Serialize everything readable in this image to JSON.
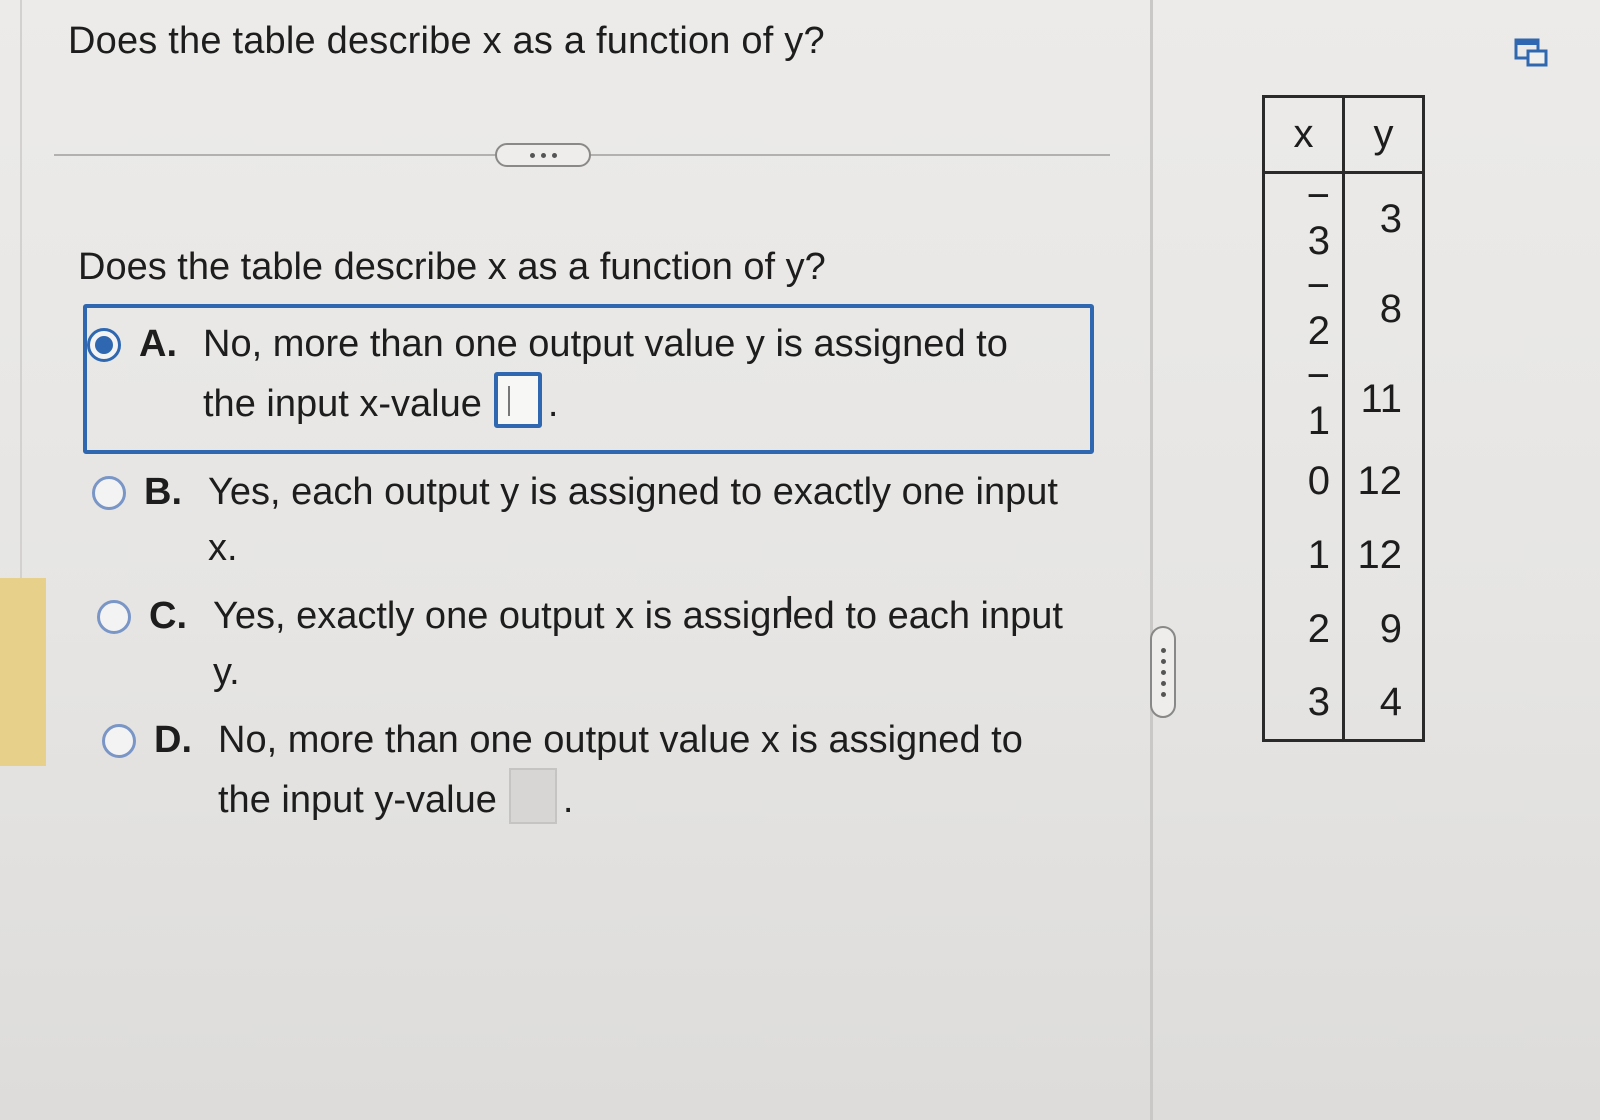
{
  "question": {
    "title": "Does the table describe x as a function of y?",
    "prompt": "Does the table describe x as a function of y?"
  },
  "options": [
    {
      "letter": "A.",
      "line1": "No, more than one output value y is assigned to",
      "line2": "the input x-value",
      "selected": true,
      "has_answer_box": true,
      "suffix": "."
    },
    {
      "letter": "B.",
      "line1": "Yes, each output y is assigned to exactly one input",
      "line2": "x.",
      "selected": false
    },
    {
      "letter": "C.",
      "line1": "Yes, exactly one output x is assigned to each input",
      "line2": "y.",
      "selected": false
    },
    {
      "letter": "D.",
      "line1": "No, more than one output value x is assigned to",
      "line2": "the input y-value",
      "selected": false,
      "has_answer_box": true,
      "suffix": "."
    }
  ],
  "table": {
    "headers": [
      "x",
      "y"
    ],
    "rows": [
      [
        "− 3",
        "3"
      ],
      [
        "− 2",
        "8"
      ],
      [
        "− 1",
        "11"
      ],
      [
        "0",
        "12"
      ],
      [
        "1",
        "12"
      ],
      [
        "2",
        "9"
      ],
      [
        "3",
        "4"
      ]
    ]
  },
  "icons": {
    "more": "ellipsis-icon",
    "resize": "vertical-grip-icon",
    "popout": "popout-window-icon",
    "cursor": "text-cursor-icon"
  },
  "colors": {
    "accent": "#2f68b0",
    "background": "#e8e7e5",
    "text": "#1d1d1d"
  }
}
